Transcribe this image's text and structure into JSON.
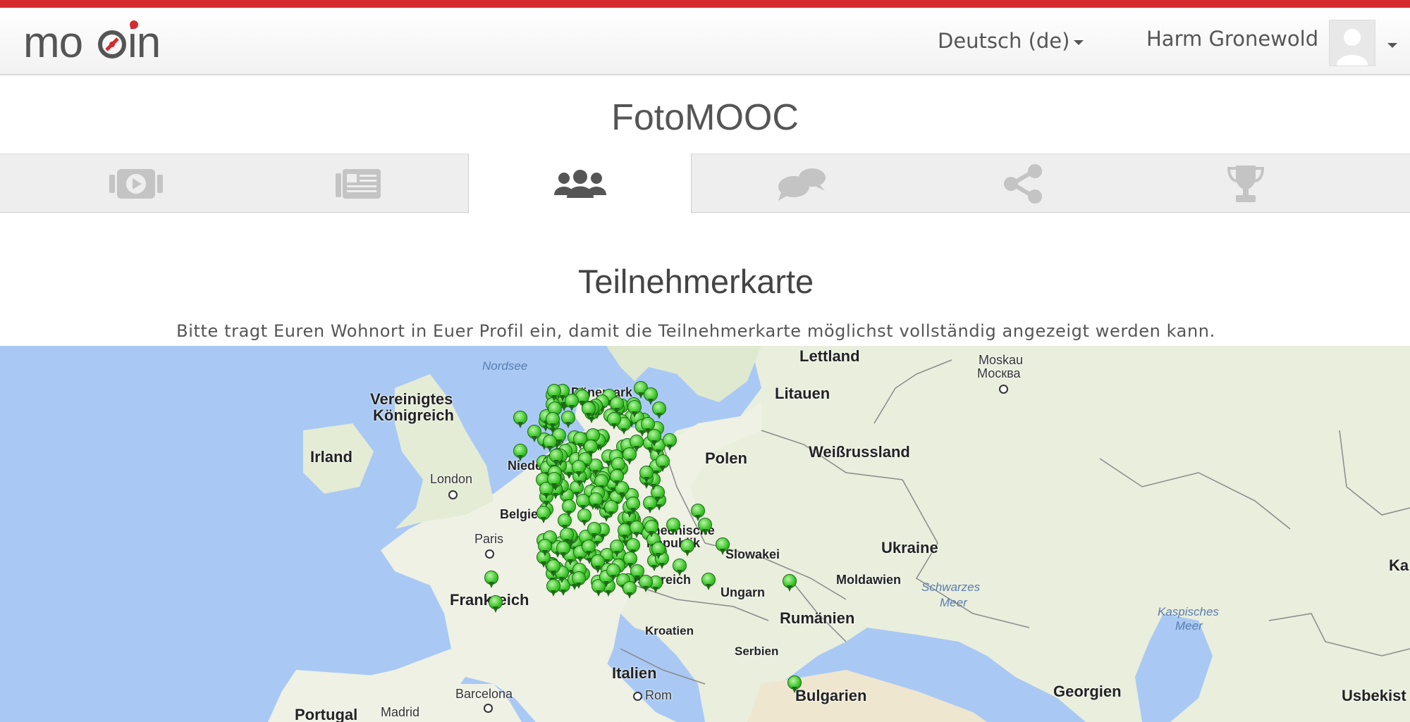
{
  "header": {
    "logo_text": "moocin",
    "language": "Deutsch (de)",
    "user_name": "Harm Gronewold",
    "accent_color": "#d52b2e"
  },
  "course": {
    "title": "FotoMOOC"
  },
  "tabs": [
    {
      "icon": "video-icon",
      "active": false
    },
    {
      "icon": "newspaper-icon",
      "active": false
    },
    {
      "icon": "users-icon",
      "active": true
    },
    {
      "icon": "comments-icon",
      "active": false
    },
    {
      "icon": "share-icon",
      "active": false
    },
    {
      "icon": "trophy-icon",
      "active": false
    }
  ],
  "page": {
    "heading": "Teilnehmerkarte",
    "notice": "Bitte tragt Euren Wohnort in Euer Profil ein, damit die Teilnehmerkarte möglichst vollständig angezeigt werden kann."
  },
  "map": {
    "countries": [
      "Lettland",
      "Litauen",
      "Dänemark",
      "Vereinigtes",
      "Königreich",
      "Irland",
      "Polen",
      "Weißrussland",
      "Belgien",
      "Tschechische",
      "Republik",
      "Slowakei",
      "Ukraine",
      "Frankreich",
      "Österreich",
      "Ungarn",
      "Moldawien",
      "Rumänien",
      "Kroatien",
      "Serbien",
      "Italien",
      "Bulgarien",
      "Georgien",
      "Portugal",
      "Usbekist",
      "Ka",
      "Niede"
    ],
    "cities": [
      "Moskau",
      "Москва",
      "London",
      "Paris",
      "Rom",
      "Barcelona",
      "Madrid"
    ],
    "seas": [
      "Nordsee",
      "Schwarzes",
      "Meer",
      "Kaspisches",
      "Meer"
    ],
    "participant_marker_color": "#3fc82b"
  }
}
